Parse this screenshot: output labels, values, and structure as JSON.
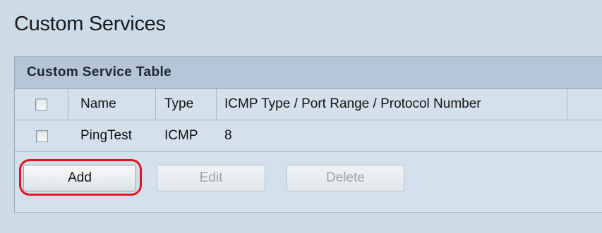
{
  "page": {
    "title": "Custom Services"
  },
  "table": {
    "caption": "Custom Service Table",
    "columns": [
      "Name",
      "Type",
      "ICMP Type / Port Range / Protocol Number"
    ],
    "rows": [
      {
        "name": "PingTest",
        "type": "ICMP",
        "value": "8"
      }
    ]
  },
  "buttons": {
    "add": "Add",
    "edit": "Edit",
    "delete": "Delete"
  },
  "colors": {
    "highlight": "#e3141c",
    "background": "#ccdbe8",
    "header": "#b3c5d6"
  }
}
